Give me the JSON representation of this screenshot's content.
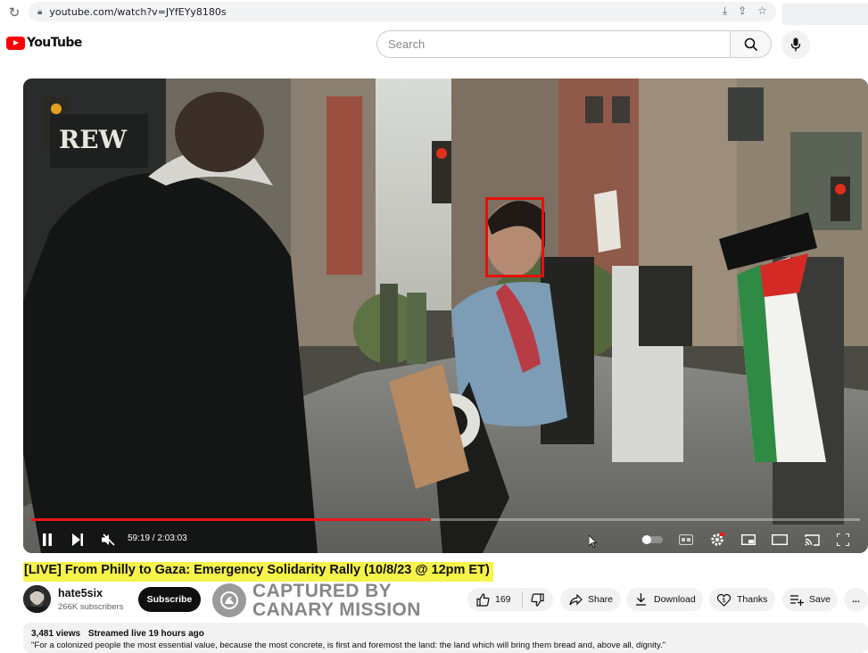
{
  "browser": {
    "url": "youtube.com/watch?v=JYfEYy8180s"
  },
  "header": {
    "logo_text": "YouTube",
    "search_placeholder": "Search"
  },
  "player": {
    "time_current": "59:19",
    "time_total": "2:03:03",
    "time_display": "59:19 / 2:03:03",
    "progress_fraction": 0.482,
    "overlay_highlight": "red box around face"
  },
  "video": {
    "title": "[LIVE] From Philly to Gaza: Emergency Solidarity Rally (10/8/23 @ 12pm ET)",
    "channel_name": "hate5six",
    "channel_subscribers": "266K subscribers",
    "subscribe_label": "Subscribe",
    "like_count": "169",
    "share_label": "Share",
    "download_label": "Download",
    "thanks_label": "Thanks",
    "save_label": "Save",
    "more_label": "..."
  },
  "watermark": {
    "line1": "CAPTURED BY",
    "line2": "CANARY MISSION"
  },
  "description": {
    "views": "3,481 views",
    "streamed": "Streamed live 19 hours ago",
    "quote": "\"For a colonized people the most essential value, because the most concrete, is first and foremost the land: the land which will bring them bread and, above all, dignity.\""
  },
  "colors": {
    "title_highlight": "#f6f34a",
    "progress": "#e6171b",
    "face_box": "#e3120b",
    "youtube_red": "#ff0000"
  }
}
